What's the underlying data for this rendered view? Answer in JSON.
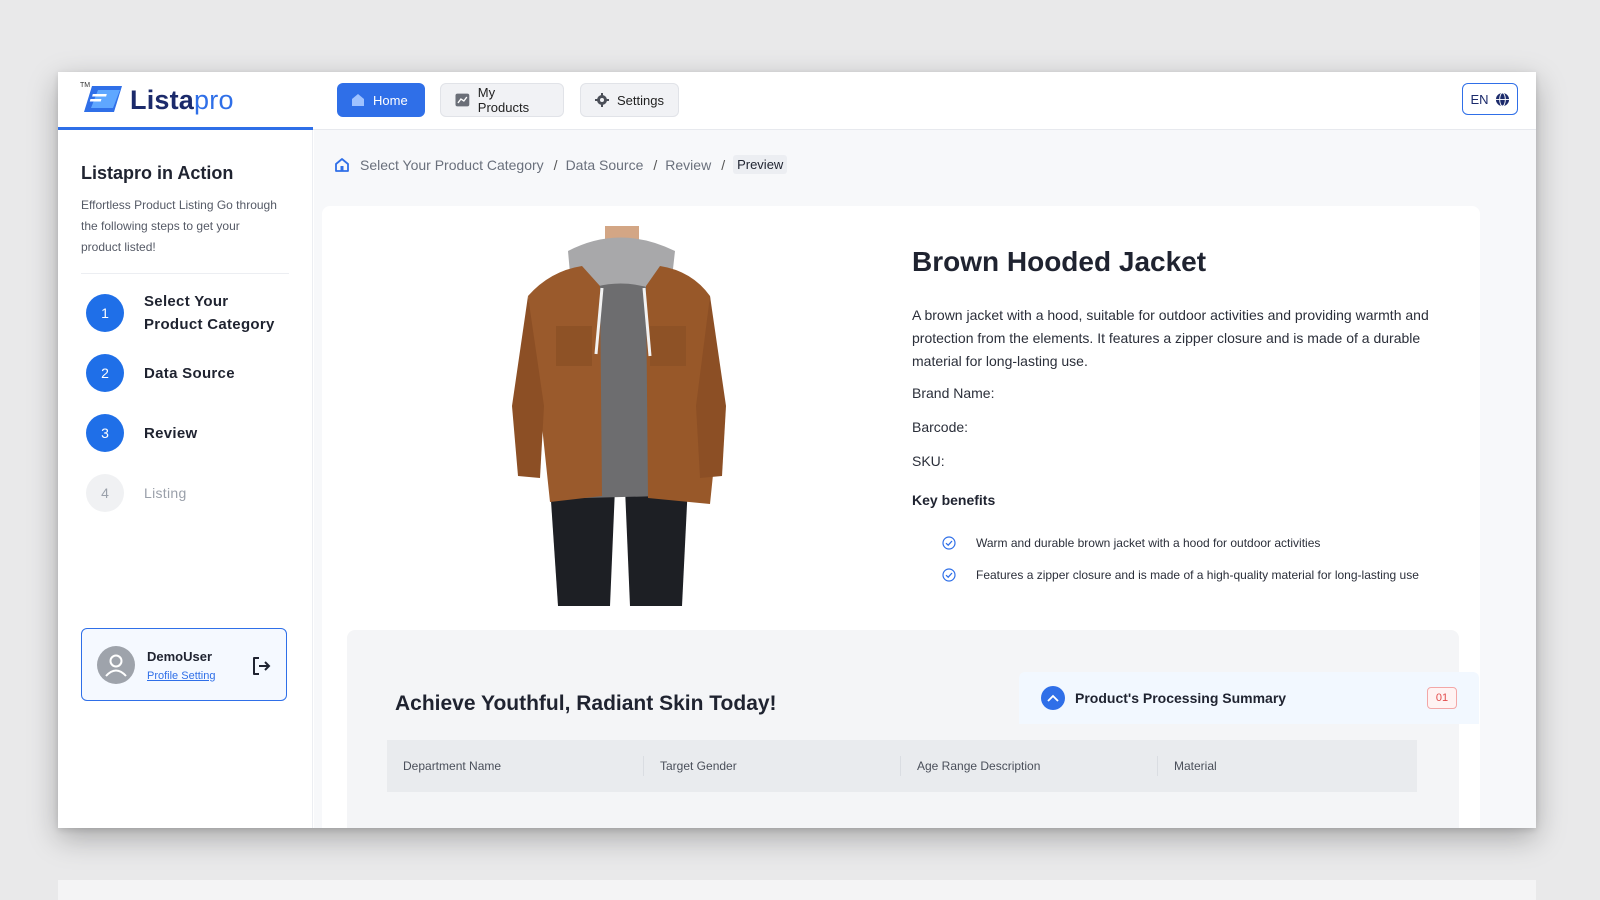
{
  "brand": {
    "name_part1": "Lista",
    "name_part2": "pro",
    "tm": "TM"
  },
  "nav": {
    "home": "Home",
    "my_products": "My Products",
    "settings": "Settings",
    "language": "EN"
  },
  "sidebar": {
    "title": "Listapro in Action",
    "description": "Effortless Product Listing Go through the following steps to get your product listed!",
    "steps": [
      {
        "num": "1",
        "label": "Select Your Product Category"
      },
      {
        "num": "2",
        "label": "Data Source"
      },
      {
        "num": "3",
        "label": "Review"
      },
      {
        "num": "4",
        "label": "Listing"
      }
    ]
  },
  "user": {
    "name": "DemoUser",
    "profile_link": "Profile Setting"
  },
  "breadcrumb": {
    "items": [
      "Select Your Product Category",
      "Data Source",
      "Review"
    ],
    "current": "Preview"
  },
  "product": {
    "title": "Brown Hooded Jacket",
    "description": "A brown jacket with a hood, suitable for outdoor activities and providing warmth and protection from the elements. It features a zipper closure and is made of a durable material for long-lasting use.",
    "brand_label": "Brand Name:",
    "barcode_label": "Barcode:",
    "sku_label": "SKU:",
    "key_benefits_title": "Key benefits",
    "benefits": [
      "Warm and durable brown jacket with a hood for outdoor activities",
      "Features a zipper closure and is made of a high-quality material for long-lasting use"
    ]
  },
  "lower": {
    "title": "Achieve Youthful, Radiant Skin Today!",
    "summary_title": "Product's Processing Summary",
    "summary_badge": "01",
    "table_headers": [
      "Department Name",
      "Target Gender",
      "Age Range Description",
      "Material"
    ]
  },
  "colors": {
    "accent": "#2f6fe8",
    "brand_dark": "#1b2a6b",
    "jacket": "#9a5a2c"
  }
}
